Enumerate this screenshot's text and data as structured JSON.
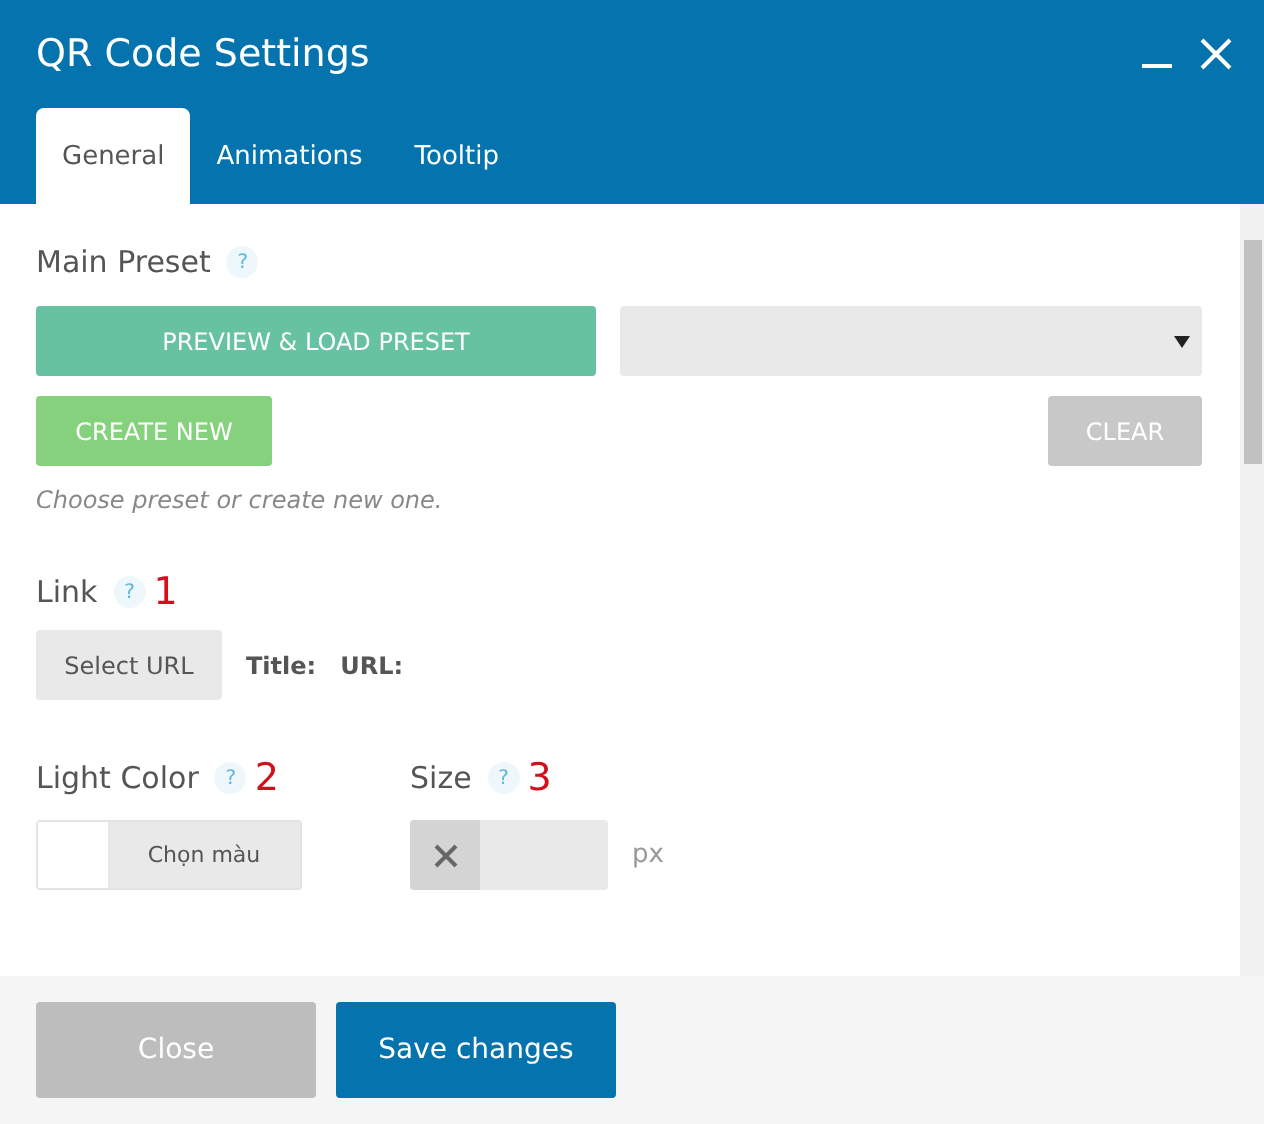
{
  "window": {
    "title": "QR Code Settings"
  },
  "tabs": [
    {
      "label": "General",
      "selected": true
    },
    {
      "label": "Animations",
      "selected": false
    },
    {
      "label": "Tooltip",
      "selected": false
    }
  ],
  "main_preset": {
    "label": "Main Preset",
    "help": "?",
    "load_button": "PREVIEW & LOAD PRESET",
    "create_button": "CREATE NEW",
    "clear_button": "CLEAR",
    "hint": "Choose preset or create new one."
  },
  "link": {
    "label": "Link",
    "help": "?",
    "annotation": "1",
    "select_button": "Select URL",
    "title_label": "Title:",
    "url_label": "URL:"
  },
  "light_color": {
    "label": "Light Color",
    "help": "?",
    "annotation": "2",
    "picker_button": "Chọn màu"
  },
  "size": {
    "label": "Size",
    "help": "?",
    "annotation": "3",
    "unit": "px"
  },
  "footer": {
    "close_button": "Close",
    "save_button": "Save changes"
  }
}
